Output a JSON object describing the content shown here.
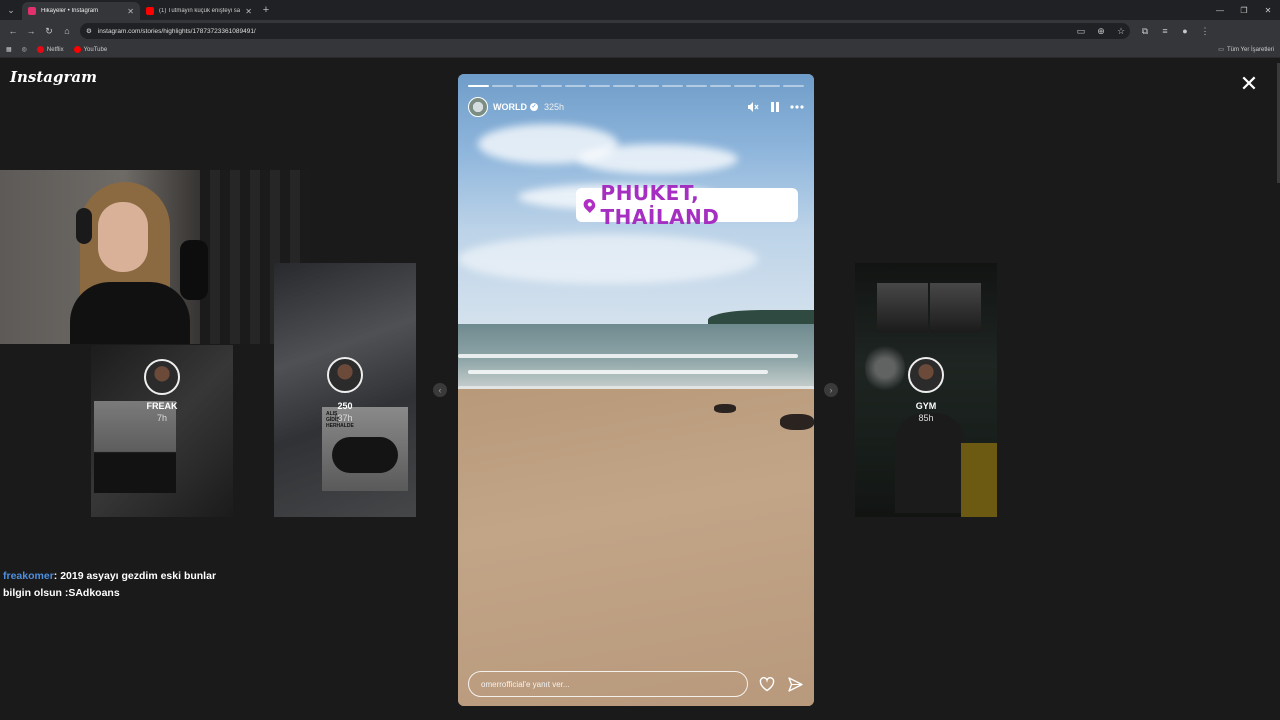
{
  "browser": {
    "tabs": [
      {
        "title": "Hikayeler • Instagram",
        "active": true,
        "favicon_color": "#e1306c"
      },
      {
        "title": "(1) Tutmayın küçük enişteyi saldı...",
        "active": false,
        "favicon_color": "#ff0000"
      }
    ],
    "url": "instagram.com/stories/highlights/17873723361089491/",
    "bookmarks": [
      {
        "label": "Netflix",
        "color": "#e50914"
      },
      {
        "label": "YouTube",
        "color": "#ff0000"
      }
    ],
    "bookmarks_right": "Tüm Yer İşaretleri"
  },
  "app": {
    "logo": "Instagram"
  },
  "side_stories": [
    {
      "name": "FREAK",
      "time": "7h"
    },
    {
      "name": "250",
      "time": "37h",
      "sticker_text": "ALIŞ\nGİDİŞ\nHERHALDE"
    },
    {
      "name": "GYM",
      "time": "85h"
    }
  ],
  "story": {
    "username": "WORLD",
    "time": "325h",
    "segments_total": 14,
    "segments_done": 1,
    "location": "PHUKET, THAİLAND",
    "reply_placeholder": "omerrofficial'e yanıt ver..."
  },
  "chat": {
    "user": "freakomer",
    "message": ": 2019 asyayı gezdim eski bunlar bilgin olsun :SAdkoans"
  },
  "icons": {
    "close": "close-icon",
    "mute": "mute-icon",
    "pause": "pause-icon",
    "more": "more-icon",
    "heart": "heart-icon",
    "send": "send-icon"
  }
}
